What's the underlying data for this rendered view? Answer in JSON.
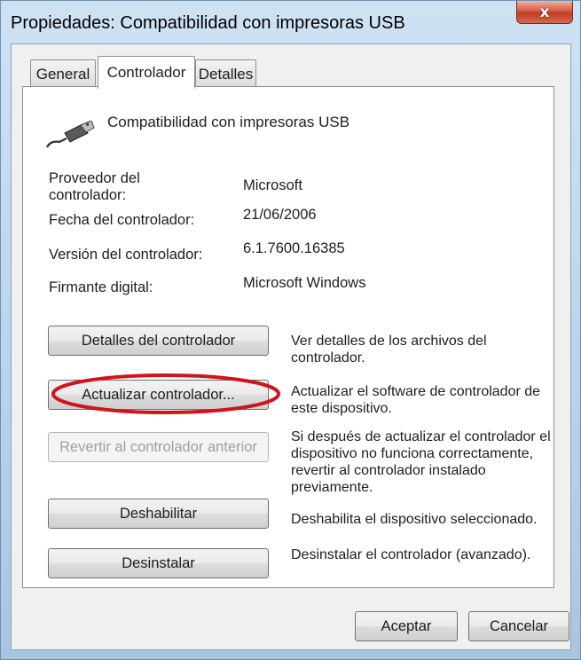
{
  "window": {
    "title": "Propiedades: Compatibilidad con impresoras USB",
    "close_glyph": "x"
  },
  "tabs": [
    {
      "label": "General",
      "active": false
    },
    {
      "label": "Controlador",
      "active": true
    },
    {
      "label": "Detalles",
      "active": false
    }
  ],
  "device": {
    "name": "Compatibilidad con impresoras USB",
    "icon": "usb-plug-icon"
  },
  "properties": [
    {
      "label": "Proveedor del controlador:",
      "value": "Microsoft"
    },
    {
      "label": "Fecha del controlador:",
      "value": "21/06/2006"
    },
    {
      "label": "Versión del controlador:",
      "value": "6.1.7600.16385"
    },
    {
      "label": "Firmante digital:",
      "value": "Microsoft Windows"
    }
  ],
  "actions": [
    {
      "label": "Detalles del controlador",
      "description": "Ver detalles de los archivos del controlador.",
      "enabled": true
    },
    {
      "label": "Actualizar controlador...",
      "description": "Actualizar el software de controlador de este dispositivo.",
      "enabled": true,
      "highlighted": true
    },
    {
      "label": "Revertir al controlador anterior",
      "description": "Si después de actualizar el controlador el dispositivo no funciona correctamente, revertir al controlador instalado previamente.",
      "enabled": false
    },
    {
      "label": "Deshabilitar",
      "description": "Deshabilita el dispositivo seleccionado.",
      "enabled": true
    },
    {
      "label": "Desinstalar",
      "description": "Desinstalar el controlador (avanzado).",
      "enabled": true
    }
  ],
  "footer": {
    "ok_label": "Aceptar",
    "cancel_label": "Cancelar"
  },
  "colors": {
    "highlight_ellipse": "#d0141c",
    "close_button": "#c13d22"
  }
}
